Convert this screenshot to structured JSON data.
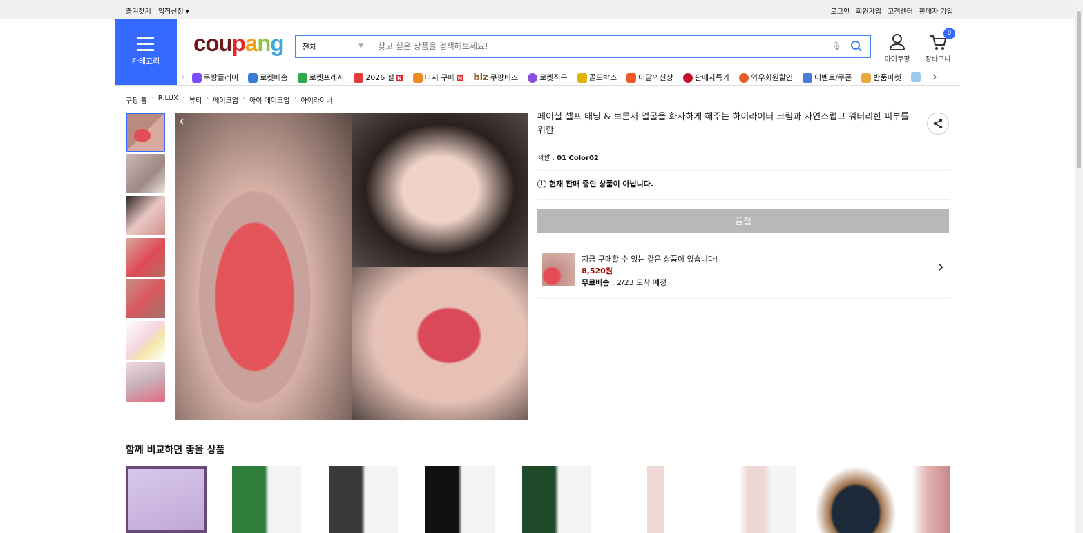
{
  "topbar": {
    "left": [
      "즐겨찾기",
      "입점신청 ▾"
    ],
    "right": [
      "로그인",
      "회원가입",
      "고객센터",
      "판매자 가입"
    ]
  },
  "header": {
    "category_label": "카테고리",
    "logo": "coupang",
    "search_scope": "전체",
    "search_placeholder": "찾고 싶은 상품을 검색해보세요!",
    "mypage_label": "마이쿠팡",
    "cart_label": "장바구니",
    "cart_count": "0"
  },
  "nav": [
    {
      "label": "쿠팡플레이",
      "color": "#7b4dff"
    },
    {
      "label": "로켓배송",
      "color": "#3a7bd5"
    },
    {
      "label": "로켓프레시",
      "color": "#2faa4a"
    },
    {
      "label": "2026 설",
      "color": "#e23b3b",
      "badge": "N"
    },
    {
      "label": "다시 구매",
      "color": "#f08a24",
      "badge": "N"
    },
    {
      "label": "쿠팡비즈",
      "prefix": "biz",
      "color": "#8b5a2b"
    },
    {
      "label": "로켓직구",
      "color": "#8a4dd8"
    },
    {
      "label": "골드박스",
      "color": "#e2b400"
    },
    {
      "label": "이달의신상",
      "color": "#f05a28"
    },
    {
      "label": "판매자특가",
      "color": "#c8102e"
    },
    {
      "label": "와우회원할인",
      "color": "#e35d2a"
    },
    {
      "label": "이벤트/쿠폰",
      "color": "#4a7bd8"
    },
    {
      "label": "반품마켓",
      "color": "#e9a93a"
    }
  ],
  "breadcrumb": [
    "쿠팡 홈",
    "R.LUX",
    "뷰티",
    "메이크업",
    "아이 메이크업",
    "아이라이너"
  ],
  "product": {
    "title": "페이셜 셀프 태닝 & 브론저 얼굴을 화사하게 해주는 하이라이터 크림과 자연스럽고 워터리한 피부를 위한",
    "option_label": "색깔 : ",
    "option_value": "01 Color02",
    "notice": "현재 판매 중인 상품이 아닙니다.",
    "sold_out_label": "품절"
  },
  "alt_offer": {
    "headline": "지금 구매할 수 있는 같은 상품이 있습니다!",
    "price": "8,520원",
    "shipping_bold": "무료배송",
    "shipping_rest": " , 2/23 도착 예정"
  },
  "compare": {
    "title": "함께 비교하면 좋을 상품"
  },
  "colors": {
    "brand_blue": "#346aff",
    "price_red": "#ae0000",
    "sold_gray": "#b8b8b8"
  }
}
